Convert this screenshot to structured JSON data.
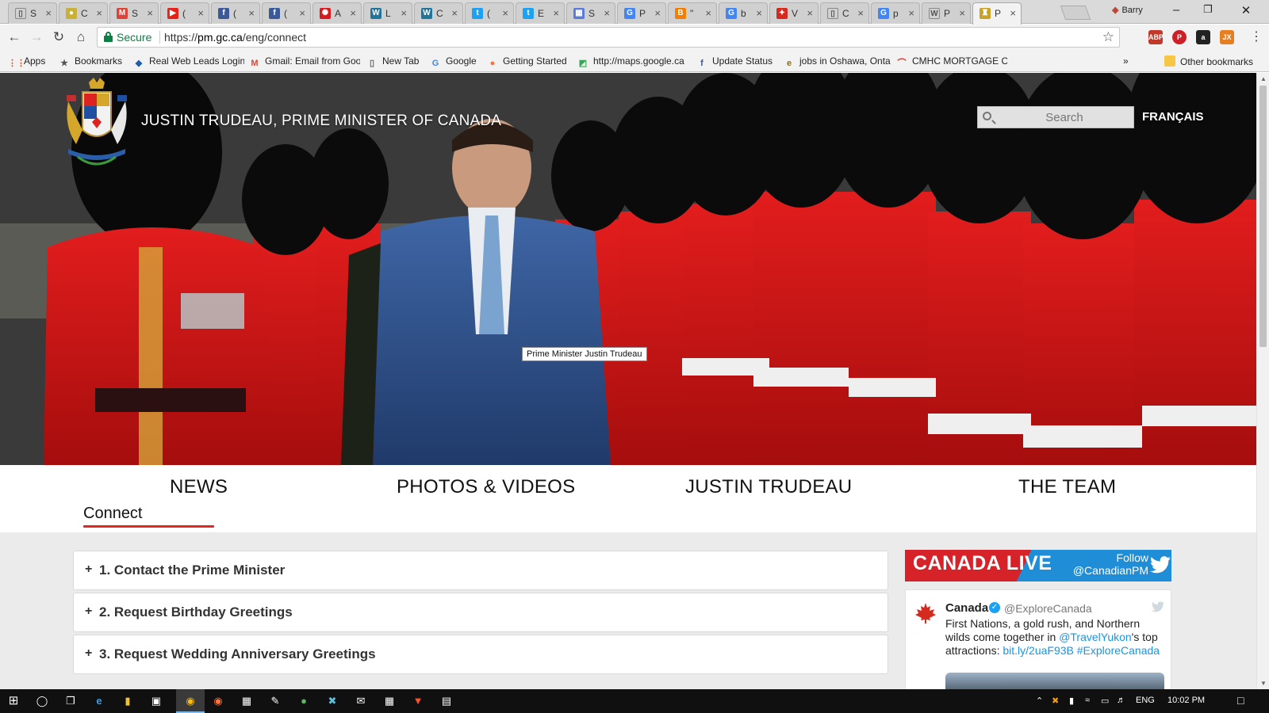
{
  "browser": {
    "tabs": [
      {
        "favicon": "document-icon",
        "title": "S",
        "color": "#ffffff"
      },
      {
        "favicon": "coin-icon",
        "title": "C",
        "color": "#c9b037"
      },
      {
        "favicon": "gmail-icon",
        "title": "S",
        "color": "#db4437"
      },
      {
        "favicon": "youtube-icon",
        "title": "(",
        "color": "#e62117"
      },
      {
        "favicon": "facebook-icon",
        "title": "(",
        "color": "#3b5998"
      },
      {
        "favicon": "facebook-icon",
        "title": "(",
        "color": "#3b5998"
      },
      {
        "favicon": "cbc-icon",
        "title": "A",
        "color": "#d71920"
      },
      {
        "favicon": "wordpress-icon",
        "title": "L",
        "color": "#21759b"
      },
      {
        "favicon": "wordpress-icon",
        "title": "C",
        "color": "#21759b"
      },
      {
        "favicon": "twitter-icon",
        "title": "(",
        "color": "#1da1f2"
      },
      {
        "favicon": "twitter-icon",
        "title": "E",
        "color": "#1da1f2"
      },
      {
        "favicon": "spreadsheet-icon",
        "title": "S",
        "color": "#5a7bd8"
      },
      {
        "favicon": "google-icon",
        "title": "P",
        "color": "#4285f4"
      },
      {
        "favicon": "blogger-icon",
        "title": "\"",
        "color": "#f57d00"
      },
      {
        "favicon": "google-icon",
        "title": "b",
        "color": "#4285f4"
      },
      {
        "favicon": "maple-leaf-icon",
        "title": "V",
        "color": "#d52b1e"
      },
      {
        "favicon": "document-icon",
        "title": "C",
        "color": "#ffffff"
      },
      {
        "favicon": "google-icon",
        "title": "p",
        "color": "#4285f4"
      },
      {
        "favicon": "wikipedia-icon",
        "title": "P",
        "color": "#ffffff"
      },
      {
        "favicon": "crest-icon",
        "title": "P",
        "color": "#c9a227"
      }
    ],
    "profile_name": "Barry",
    "address": {
      "secure_label": "Secure",
      "scheme": "https://",
      "host": "pm.gc.ca",
      "path": "/eng/connect"
    },
    "bookmarks": [
      {
        "label": "Apps",
        "icon": "apps-grid-icon"
      },
      {
        "label": "Bookmarks",
        "icon": "star-icon"
      },
      {
        "label": "Real Web Leads Login",
        "icon": "leads-icon"
      },
      {
        "label": "Gmail: Email from Google",
        "icon": "gmail-icon"
      },
      {
        "label": "New Tab",
        "icon": "document-icon"
      },
      {
        "label": "Google",
        "icon": "google-icon"
      },
      {
        "label": "Getting Started",
        "icon": "firefox-icon"
      },
      {
        "label": "http://maps.google.ca",
        "icon": "maps-icon"
      },
      {
        "label": "Update Status",
        "icon": "facebook-icon"
      },
      {
        "label": "jobs in Oshawa, Ontario",
        "icon": "edge-e-icon"
      },
      {
        "label": "CMHC MORTGAGE CALCULATOR",
        "icon": "cmhc-icon"
      }
    ],
    "overflow_label": "»",
    "other_bookmarks": "Other bookmarks"
  },
  "site": {
    "title": "JUSTIN TRUDEAU, PRIME MINISTER OF CANADA",
    "search_placeholder": "Search",
    "language_toggle": "FRANÇAIS",
    "photo_caption": "Prime Minister Justin Trudeau",
    "nav": [
      "NEWS",
      "PHOTOS & VIDEOS",
      "JUSTIN TRUDEAU",
      "THE TEAM"
    ],
    "subnav_active": "Connect",
    "accordion": [
      {
        "label": "1. Contact the Prime Minister"
      },
      {
        "label": "2. Request Birthday Greetings"
      },
      {
        "label": "3. Request Wedding Anniversary Greetings"
      }
    ],
    "twitter": {
      "banner": "CANADA LIVE",
      "follow_label": "Follow",
      "follow_handle": "@CanadianPM",
      "tweet": {
        "name": "Canada",
        "handle": "@ExploreCanada",
        "text_1": "First Nations, a gold rush, and Northern wilds come together in ",
        "mention": "@TravelYukon",
        "text_2": "'s top attractions: ",
        "link": "bit.ly/2uaF93B",
        "hashtag": "#ExploreCanada"
      }
    },
    "accent_red": "#e4261f",
    "twitter_blue": "#1f8ed6"
  },
  "taskbar": {
    "language": "ENG",
    "time": "10:02 PM"
  }
}
